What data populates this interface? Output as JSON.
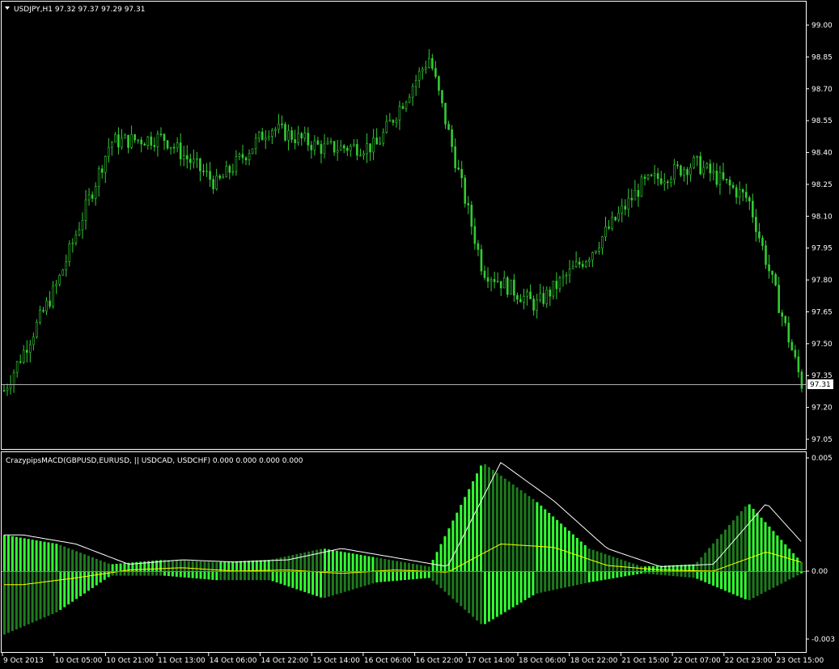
{
  "main_chart": {
    "symbol_header": "USDJPY,H1  97.32 97.37 97.29 97.31",
    "current_price_label": "97.31",
    "price_ticks": [
      "99.00",
      "98.85",
      "98.70",
      "98.55",
      "98.40",
      "98.25",
      "98.10",
      "97.95",
      "97.80",
      "97.65",
      "97.50",
      "97.35",
      "97.20",
      "97.05"
    ]
  },
  "indicator": {
    "header": "CrazypipsMACD(GBPUSD,EURUSD, || USDCAD, USDCHF) 0.000 0.000 0.000 0.000",
    "ticks": [
      "0.005",
      "0.00",
      "-0.003"
    ]
  },
  "time_axis": {
    "labels": [
      "9 Oct 2013",
      "10 Oct 05:00",
      "10 Oct 21:00",
      "11 Oct 13:00",
      "14 Oct 06:00",
      "14 Oct 22:00",
      "15 Oct 14:00",
      "16 Oct 06:00",
      "16 Oct 22:00",
      "17 Oct 14:00",
      "18 Oct 06:00",
      "18 Oct 22:00",
      "21 Oct 15:00",
      "22 Oct 07:00",
      "22 Oct 23:00",
      "23 Oct 15:00"
    ]
  },
  "colors": {
    "background": "#000000",
    "candle": "#32cd32",
    "hist_bright": "#32ff32",
    "hist_dark": "#1e7a1e",
    "signal_white": "#ffffff",
    "signal_yellow": "#ffff00",
    "axis": "#ffffff",
    "price_line": "#b0b0b0"
  },
  "chart_data": [
    {
      "type": "candlestick",
      "title": "USDJPY,H1",
      "ylim": [
        97.0,
        99.05
      ],
      "current_price": 97.31,
      "x": [
        "9 Oct 2013",
        "10 Oct 05:00",
        "10 Oct 21:00",
        "11 Oct 13:00",
        "14 Oct 06:00",
        "14 Oct 22:00",
        "15 Oct 14:00",
        "16 Oct 06:00",
        "16 Oct 22:00",
        "17 Oct 14:00",
        "18 Oct 06:00",
        "18 Oct 22:00",
        "21 Oct 15:00",
        "22 Oct 07:00",
        "22 Oct 23:00",
        "23 Oct 15:00"
      ],
      "close_path": [
        [
          0,
          97.28
        ],
        [
          1,
          97.78
        ],
        [
          2,
          98.45
        ],
        [
          3,
          98.47
        ],
        [
          4,
          98.25
        ],
        [
          5,
          98.52
        ],
        [
          6,
          98.42
        ],
        [
          7,
          98.43
        ],
        [
          8,
          98.85
        ],
        [
          9,
          97.85
        ],
        [
          10,
          97.68
        ],
        [
          11,
          97.92
        ],
        [
          12,
          98.25
        ],
        [
          13,
          98.35
        ],
        [
          14,
          98.18
        ],
        [
          15,
          97.31
        ]
      ]
    },
    {
      "type": "histogram",
      "title": "CrazypipsMACD(GBPUSD,EURUSD, || USDCAD, USDCHF)",
      "ylim": [
        -0.0035,
        0.0052
      ],
      "x": [
        "9 Oct 2013",
        "10 Oct 05:00",
        "10 Oct 21:00",
        "11 Oct 13:00",
        "14 Oct 06:00",
        "14 Oct 22:00",
        "15 Oct 14:00",
        "16 Oct 06:00",
        "16 Oct 22:00",
        "17 Oct 14:00",
        "18 Oct 06:00",
        "18 Oct 22:00",
        "21 Oct 15:00",
        "22 Oct 07:00",
        "22 Oct 23:00",
        "23 Oct 15:00"
      ],
      "series": [
        {
          "name": "GBPUSD,EURUSD",
          "values": [
            0.0016,
            0.0012,
            0.0003,
            0.0005,
            0.0004,
            0.0005,
            0.001,
            0.0006,
            0.0002,
            0.0048,
            0.0031,
            0.001,
            0.0002,
            0.0003,
            0.003,
            0.0004
          ]
        },
        {
          "name": "USDCAD, USDCHF",
          "values": [
            -0.0028,
            -0.0018,
            -0.0002,
            -0.0002,
            -0.0004,
            -0.0004,
            -0.0012,
            -0.0005,
            -0.0003,
            -0.0024,
            -0.001,
            -0.0005,
            -0.0001,
            -0.0003,
            -0.0013,
            -0.0001
          ]
        }
      ]
    }
  ]
}
